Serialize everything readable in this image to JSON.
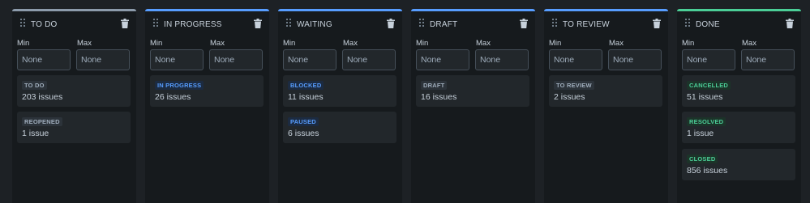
{
  "labels": {
    "min": "Min",
    "max": "Max",
    "placeholder": "None"
  },
  "colors": {
    "todo": "#8c9bab",
    "in_progress": "#579dff",
    "waiting": "#579dff",
    "draft": "#579dff",
    "to_review": "#579dff",
    "done": "#4bce97"
  },
  "columns": [
    {
      "title": "TO DO",
      "cards": [
        {
          "status": "TO DO",
          "count": "203 issues"
        },
        {
          "status": "REOPENED",
          "count": "1 issue"
        }
      ]
    },
    {
      "title": "IN PROGRESS",
      "cards": [
        {
          "status": "IN PROGRESS",
          "count": "26 issues"
        }
      ]
    },
    {
      "title": "WAITING",
      "cards": [
        {
          "status": "BLOCKED",
          "count": "11 issues"
        },
        {
          "status": "PAUSED",
          "count": "6 issues"
        }
      ]
    },
    {
      "title": "DRAFT",
      "cards": [
        {
          "status": "DRAFT",
          "count": "16 issues"
        }
      ]
    },
    {
      "title": "TO REVIEW",
      "cards": [
        {
          "status": "TO REVIEW",
          "count": "2 issues"
        }
      ]
    },
    {
      "title": "DONE",
      "cards": [
        {
          "status": "CANCELLED",
          "count": "51 issues"
        },
        {
          "status": "RESOLVED",
          "count": "1 issue"
        },
        {
          "status": "CLOSED",
          "count": "856 issues"
        }
      ]
    }
  ]
}
